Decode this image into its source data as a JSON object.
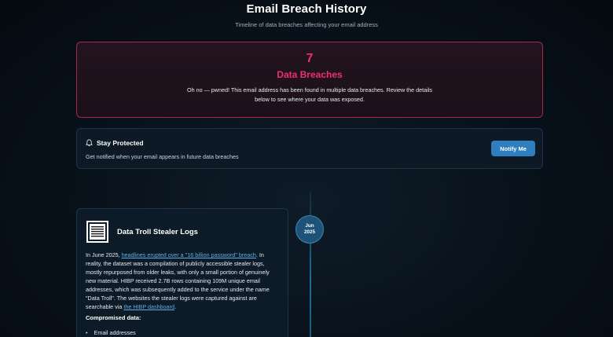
{
  "header": {
    "title": "Email Breach History",
    "subtitle": "Timeline of data breaches affecting your email address"
  },
  "alert": {
    "count": "7",
    "label": "Data Breaches",
    "message": "Oh no — pwned! This email address has been found in multiple data breaches. Review the details below to see where your data was exposed."
  },
  "protect": {
    "icon": "bell-icon",
    "title": "Stay Protected",
    "description": "Get notified when your email appears in future data breaches",
    "button_label": "Notify Me"
  },
  "timeline": {
    "date_month": "Jun",
    "date_year": "2025"
  },
  "breach": {
    "icon": "document-icon",
    "title": "Data Troll Stealer Logs",
    "desc_part1": "In June 2025, ",
    "link1": "headlines erupted over a \"16 billion password\" breach",
    "desc_part2": ". In reality, the dataset was a compilation of publicly accessible stealer logs, mostly repurposed from older leaks, with only a small portion of genuinely new material. HIBP received 2.7B rows containing 109M unique email addresses, which was subsequently added to the service under the name \"Data Troll\". The websites the stealer logs were captured against are searchable via ",
    "link2": "the HIBP dashboard",
    "desc_part3": ".",
    "compromised_title": "Compromised data:",
    "compromised_items": [
      "Email addresses"
    ]
  },
  "colors": {
    "accent": "#ef2e6b",
    "button": "#2f7fc0",
    "link": "#5ab0e6"
  }
}
